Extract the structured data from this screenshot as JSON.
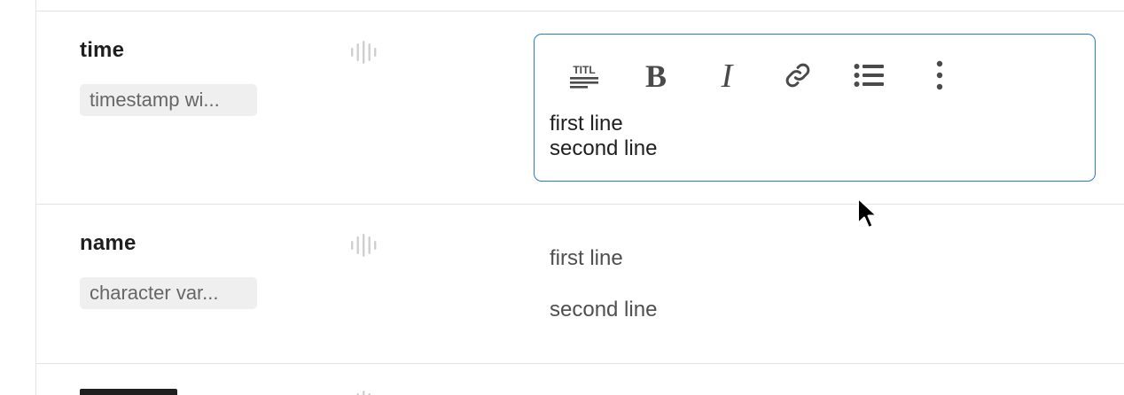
{
  "rows": [
    {
      "field_name": "time",
      "type_label": "timestamp wi...",
      "editor": {
        "toolbar": {
          "title_icon": "title-icon",
          "bold_icon": "bold-icon",
          "italic_icon": "italic-icon",
          "link_icon": "link-icon",
          "list_icon": "bullet-list-icon",
          "more_icon": "more-vertical-icon"
        },
        "lines": [
          "first line",
          "second line"
        ]
      }
    },
    {
      "field_name": "name",
      "type_label": "character var...",
      "value_lines": [
        "first line",
        "second line"
      ]
    }
  ],
  "colors": {
    "accent": "#2b78d4",
    "divider": "#e3e3e3",
    "badge_bg": "#efefef"
  }
}
